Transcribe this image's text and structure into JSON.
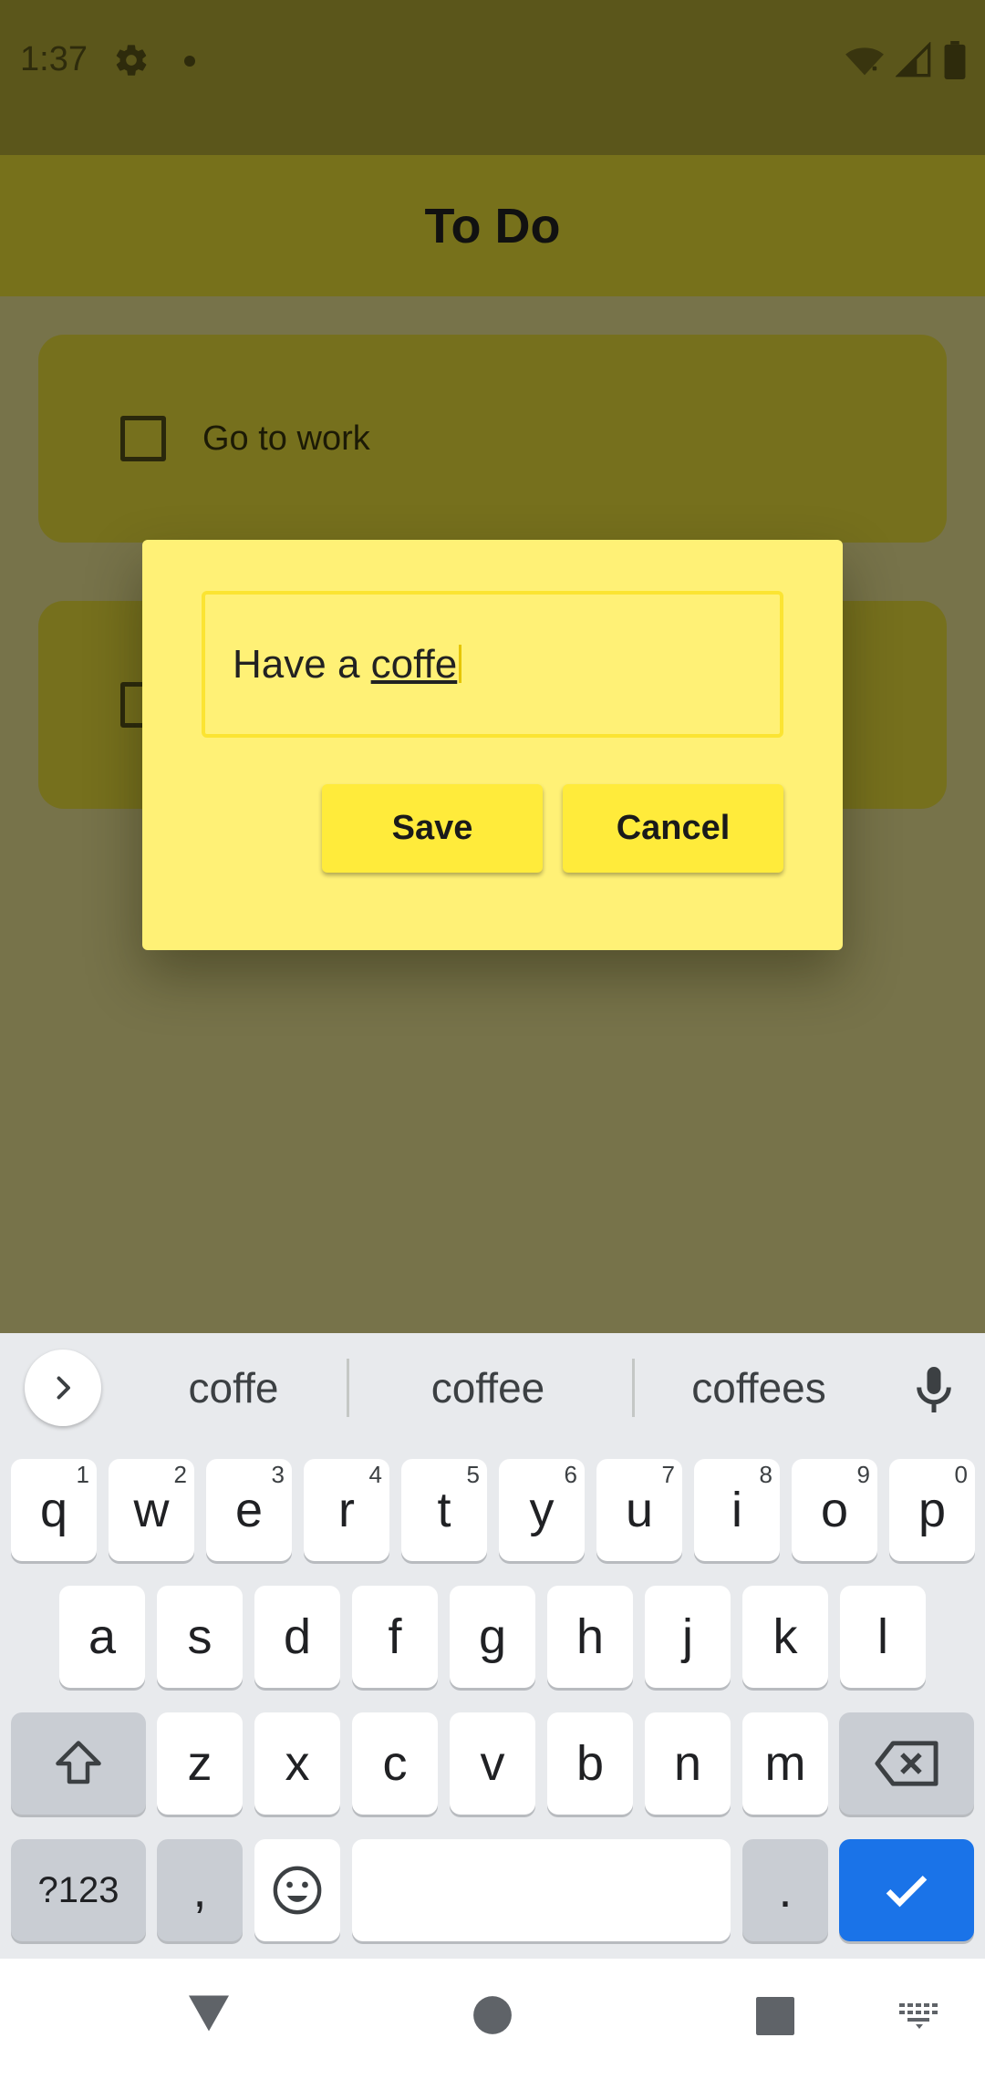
{
  "status": {
    "time": "1:37"
  },
  "app": {
    "title": "To Do"
  },
  "tasks": [
    {
      "label": "Go to work"
    },
    {
      "label": ""
    }
  ],
  "dialog": {
    "input_prefix": "Have a ",
    "input_composing": "coffe",
    "save_label": "Save",
    "cancel_label": "Cancel"
  },
  "keyboard": {
    "suggestions": [
      "coffe",
      "coffee",
      "coffees"
    ],
    "row1": [
      {
        "k": "q",
        "h": "1"
      },
      {
        "k": "w",
        "h": "2"
      },
      {
        "k": "e",
        "h": "3"
      },
      {
        "k": "r",
        "h": "4"
      },
      {
        "k": "t",
        "h": "5"
      },
      {
        "k": "y",
        "h": "6"
      },
      {
        "k": "u",
        "h": "7"
      },
      {
        "k": "i",
        "h": "8"
      },
      {
        "k": "o",
        "h": "9"
      },
      {
        "k": "p",
        "h": "0"
      }
    ],
    "row2": [
      "a",
      "s",
      "d",
      "f",
      "g",
      "h",
      "j",
      "k",
      "l"
    ],
    "row3": [
      "z",
      "x",
      "c",
      "v",
      "b",
      "n",
      "m"
    ],
    "symbols_label": "?123",
    "comma_label": ",",
    "period_label": "."
  },
  "colors": {
    "accent_yellow": "#ffeb3b",
    "dialog_bg": "#fff176",
    "enter_blue": "#1a73e8"
  },
  "icons": [
    "settings-gear-icon",
    "wifi-icon",
    "signal-icon",
    "battery-icon",
    "plus-icon",
    "chevron-right-icon",
    "mic-icon",
    "shift-icon",
    "backspace-icon",
    "emoji-icon",
    "check-icon",
    "back-triangle-icon",
    "home-circle-icon",
    "recents-square-icon",
    "keyboard-switch-icon"
  ]
}
